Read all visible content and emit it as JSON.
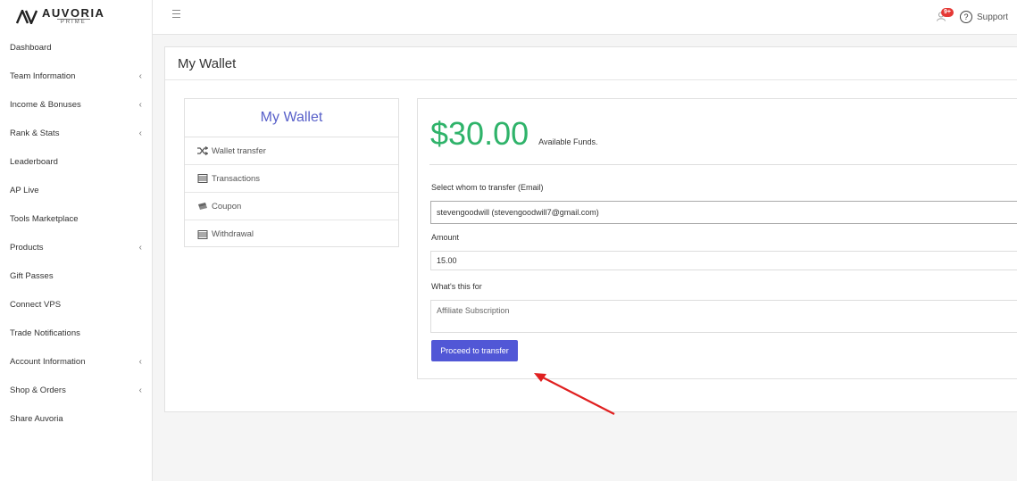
{
  "brand": {
    "name": "AUVORIA",
    "sub": "PRIME"
  },
  "sidebar": {
    "items": [
      {
        "label": "Dashboard",
        "chevron": ""
      },
      {
        "label": "Team Information",
        "chevron": "‹"
      },
      {
        "label": "Income & Bonuses",
        "chevron": "‹"
      },
      {
        "label": "Rank & Stats",
        "chevron": "‹"
      },
      {
        "label": "Leaderboard",
        "chevron": ""
      },
      {
        "label": "AP Live",
        "chevron": ""
      },
      {
        "label": "Tools Marketplace",
        "chevron": ""
      },
      {
        "label": "Products",
        "chevron": "‹"
      },
      {
        "label": "Gift Passes",
        "chevron": ""
      },
      {
        "label": "Connect VPS",
        "chevron": ""
      },
      {
        "label": "Trade Notifications",
        "chevron": ""
      },
      {
        "label": "Account Information",
        "chevron": "‹"
      },
      {
        "label": "Shop & Orders",
        "chevron": "‹"
      },
      {
        "label": "Share Auvoria",
        "chevron": ""
      }
    ]
  },
  "topbar": {
    "badge": "9+",
    "support": "Support",
    "help_glyph": "?"
  },
  "page": {
    "title": "My Wallet"
  },
  "wallet_menu": {
    "title": "My Wallet",
    "items": [
      {
        "label": "Wallet transfer",
        "icon": "shuffle-icon"
      },
      {
        "label": "Transactions",
        "icon": "list-icon"
      },
      {
        "label": "Coupon",
        "icon": "coupon-icon"
      },
      {
        "label": "Withdrawal",
        "icon": "list-icon"
      }
    ]
  },
  "wallet": {
    "amount": "$30.00",
    "available_label": "Available Funds.",
    "recipient_label": "Select whom to transfer (Email)",
    "recipient_value": "stevengoodwill (stevengoodwill7@gmail.com)",
    "amount_label": "Amount",
    "amount_value": "15.00",
    "purpose_label": "What's this for",
    "purpose_placeholder": "Affiliate Subscription",
    "submit_label": "Proceed to transfer"
  },
  "colors": {
    "accent": "#5157d6",
    "amount": "#2fb36a",
    "menu_title": "#5860c9",
    "annotation": "#e02020"
  }
}
